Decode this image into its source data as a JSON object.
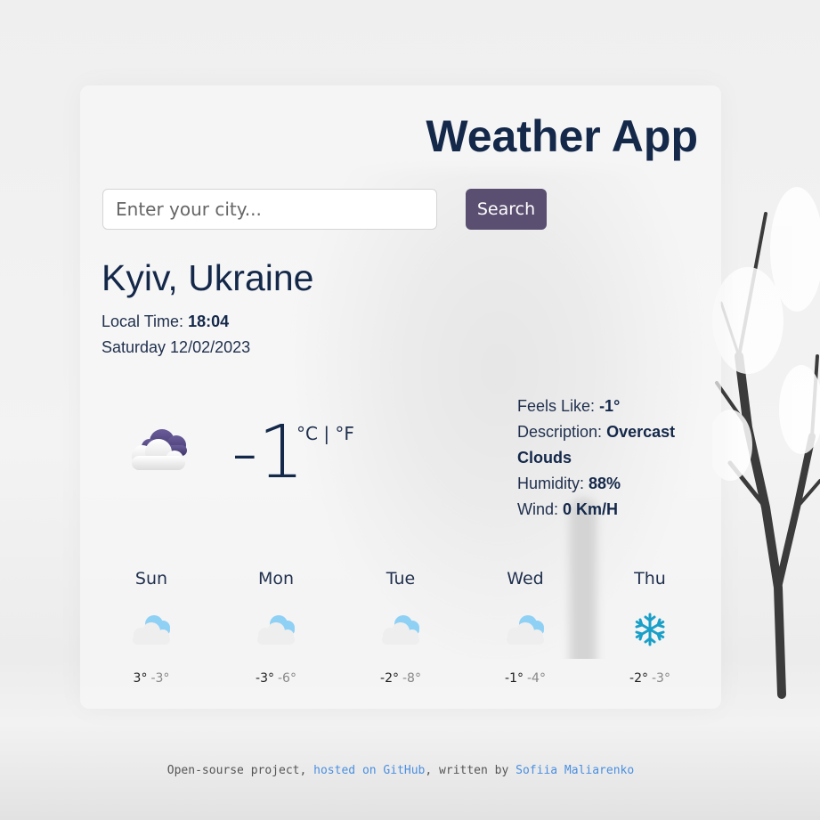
{
  "app": {
    "title": "Weather App"
  },
  "search": {
    "placeholder": "Enter your city...",
    "button_label": "Search"
  },
  "current": {
    "city": "Kyiv, Ukraine",
    "local_time_label": "Local Time:",
    "local_time": "18:04",
    "date": "Saturday 12/02/2023",
    "icon": "cloud-icon",
    "temperature": "-1",
    "unit_c": "°C",
    "unit_sep": " | ",
    "unit_f": "°F",
    "feels_like_label": "Feels Like:",
    "feels_like": "-1°",
    "description_label": "Description:",
    "description": "Overcast Clouds",
    "humidity_label": "Humidity:",
    "humidity": "88%",
    "wind_label": "Wind:",
    "wind": "0 Km/H"
  },
  "forecast": [
    {
      "day": "Sun",
      "icon": "cloud-icon",
      "max": "3°",
      "min": "-3°"
    },
    {
      "day": "Mon",
      "icon": "cloud-icon",
      "max": "-3°",
      "min": "-6°"
    },
    {
      "day": "Tue",
      "icon": "cloud-icon",
      "max": "-2°",
      "min": "-8°"
    },
    {
      "day": "Wed",
      "icon": "cloud-icon",
      "max": "-1°",
      "min": "-4°"
    },
    {
      "day": "Thu",
      "icon": "snowflake-icon",
      "max": "-2°",
      "min": "-3°"
    }
  ],
  "footer": {
    "prefix": "Open-sourse project, ",
    "link1": "hosted on GitHub",
    "middle": ", written by ",
    "link2": "Sofiia Maliarenko"
  },
  "colors": {
    "title": "#14284a",
    "button": "#5a4f70",
    "link": "#4a8fe0",
    "cloud_dark": "#4f4378",
    "cloud_light": "#8fd0f5",
    "snowflake": "#1aa0c8"
  }
}
